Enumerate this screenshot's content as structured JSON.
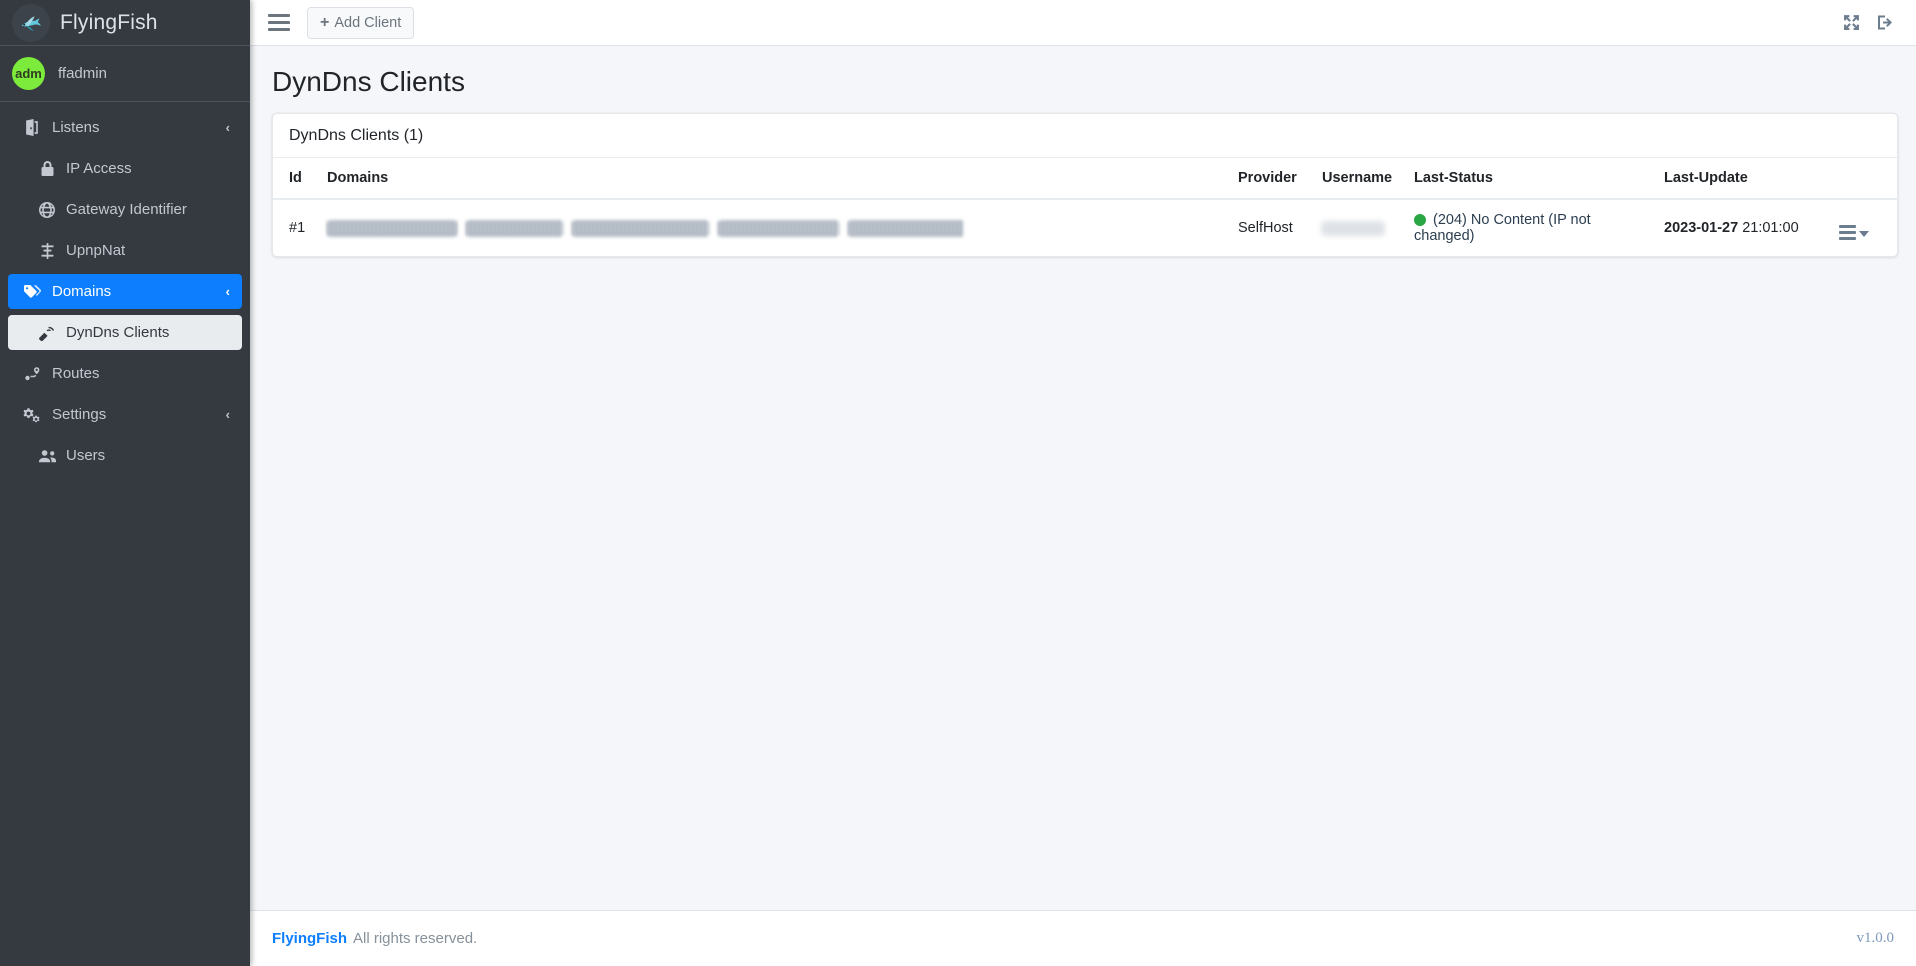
{
  "sidebar": {
    "brand": {
      "title": "FlyingFish",
      "logo_icon": "flying-fish-logo-icon"
    },
    "user": {
      "avatar_text": "adm",
      "name": "ffadmin",
      "avatar_color": "#7ceb3c"
    },
    "items": [
      {
        "label": "Listens",
        "icon": "door-open-icon",
        "level": "parent",
        "state": "default",
        "caret": "‹"
      },
      {
        "label": "IP Access",
        "icon": "lock-icon",
        "level": "child",
        "state": "default",
        "caret": ""
      },
      {
        "label": "Gateway Identifier",
        "icon": "globe-icon",
        "level": "child",
        "state": "default",
        "caret": ""
      },
      {
        "label": "UpnpNat",
        "icon": "sliders-icon",
        "level": "child",
        "state": "default",
        "caret": ""
      },
      {
        "label": "Domains",
        "icon": "tags-icon",
        "level": "parent",
        "state": "active-blue",
        "caret": "‹"
      },
      {
        "label": "DynDns Clients",
        "icon": "satellite-dish-icon",
        "level": "child",
        "state": "active-light",
        "caret": ""
      },
      {
        "label": "Routes",
        "icon": "route-icon",
        "level": "parent",
        "state": "default",
        "caret": ""
      },
      {
        "label": "Settings",
        "icon": "cogs-icon",
        "level": "parent",
        "state": "default",
        "caret": "‹"
      },
      {
        "label": "Users",
        "icon": "users-icon",
        "level": "child",
        "state": "default",
        "caret": ""
      }
    ]
  },
  "topbar": {
    "menu_toggle_icon": "hamburger-menu-icon",
    "add_client_label": "Add Client",
    "add_client_icon": "plus-icon",
    "fullscreen_icon": "expand-arrows-icon",
    "logout_icon": "sign-out-icon"
  },
  "page": {
    "title": "DynDns Clients",
    "card_header": "DynDns Clients (1)"
  },
  "table": {
    "columns": [
      "Id",
      "Domains",
      "Provider",
      "Username",
      "Last-Status",
      "Last-Update",
      ""
    ],
    "rows": [
      {
        "id": "#1",
        "domains_redacted_widths": [
          130,
          97,
          137,
          121,
          116
        ],
        "provider": "SelfHost",
        "username_redacted_width": 62,
        "status_code": "(204) No Content (IP not changed)",
        "status_color": "#2aa745",
        "last_update_date": "2023-01-27",
        "last_update_time": "21:01:00",
        "row_menu_icon": "list-menu-caret-icon"
      }
    ]
  },
  "footer": {
    "brand": "FlyingFish",
    "text": "All rights reserved.",
    "version": "v1.0.0"
  },
  "colors": {
    "sidebar_bg": "#343a40",
    "accent_blue": "#0d7efd",
    "content_bg": "#f4f6f9",
    "status_green": "#2aa745"
  }
}
